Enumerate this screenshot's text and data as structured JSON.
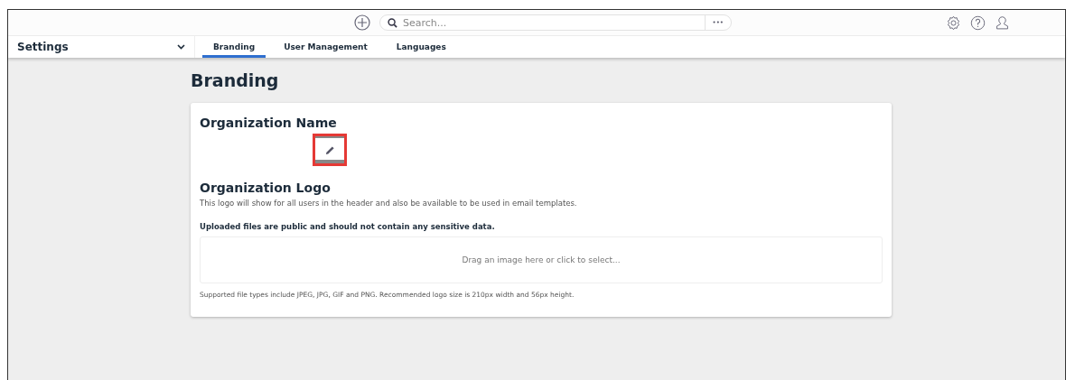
{
  "top_bar": {
    "search": {
      "placeholder": "Search..."
    },
    "more": "•••"
  },
  "nav": {
    "title": "Settings",
    "tabs": [
      {
        "label": "Branding",
        "selected": true
      },
      {
        "label": "User Management",
        "selected": false
      },
      {
        "label": "Languages",
        "selected": false
      }
    ]
  },
  "page": {
    "title": "Branding",
    "sections": [
      {
        "heading": "Organization Name",
        "edit_highlighted": true
      },
      {
        "heading": "Organization Logo",
        "description": "This logo will show for all users in the header and also be available to be used in email templates.",
        "warning": "Uploaded files are public and should not contain any sensitive data.",
        "dropzone": "Drag an image here or click to select...",
        "note": "Supported file types include JPEG, JPG, GIF and PNG. Recommended logo size is 210px width and 56px height."
      }
    ]
  }
}
